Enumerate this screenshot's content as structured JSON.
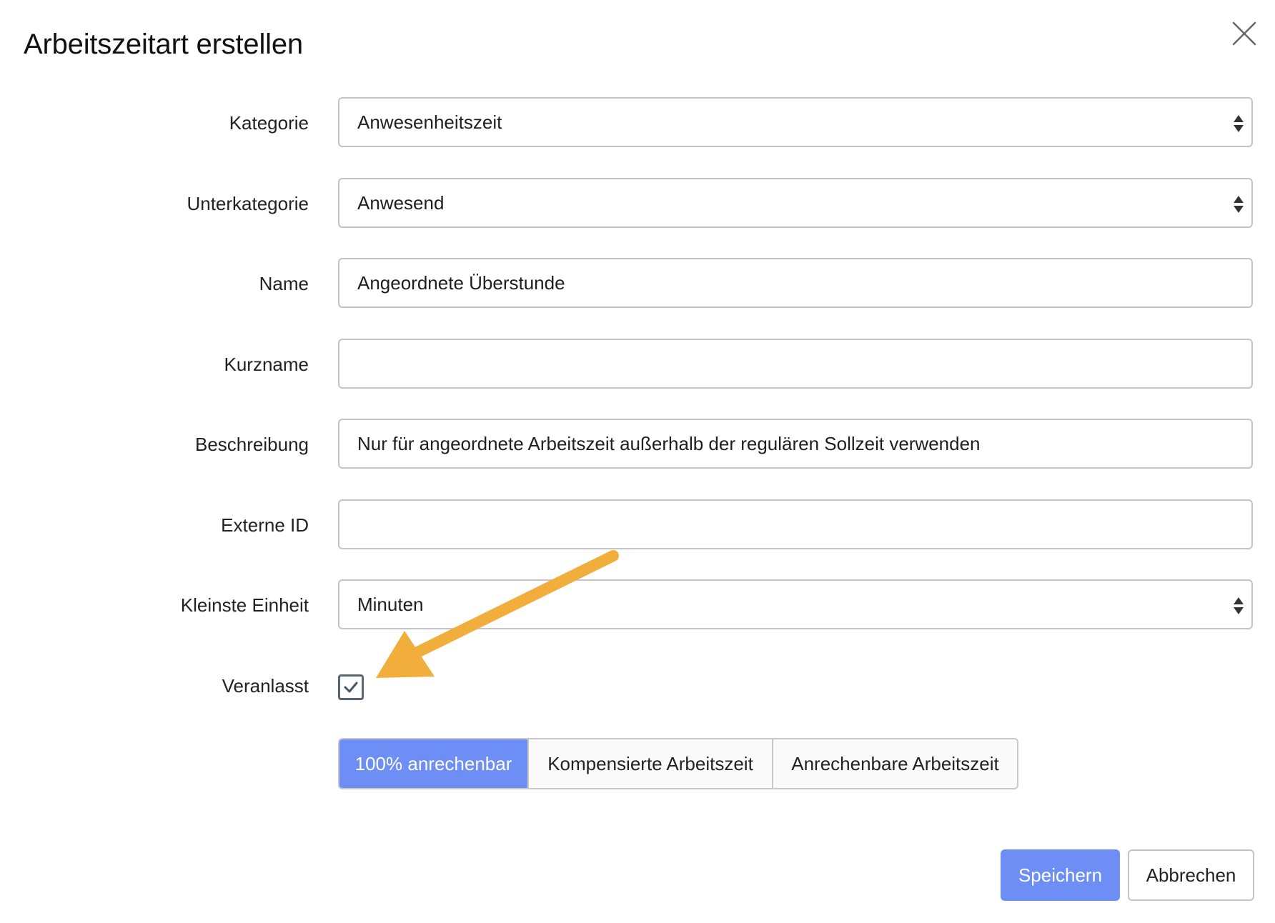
{
  "dialog": {
    "title": "Arbeitszeitart erstellen",
    "close_icon": "close-icon"
  },
  "form": {
    "kategorie": {
      "label": "Kategorie",
      "value": "Anwesenheitszeit",
      "type": "select"
    },
    "unterkategorie": {
      "label": "Unterkategorie",
      "value": "Anwesend",
      "type": "select"
    },
    "name": {
      "label": "Name",
      "value": "Angeordnete Überstunde",
      "type": "text"
    },
    "kurzname": {
      "label": "Kurzname",
      "value": "",
      "type": "text"
    },
    "beschreibung": {
      "label": "Beschreibung",
      "value": "Nur für angeordnete Arbeitszeit außerhalb der regulären Sollzeit verwenden",
      "type": "text"
    },
    "externe_id": {
      "label": "Externe ID",
      "value": "",
      "type": "text"
    },
    "kleinste_einheit": {
      "label": "Kleinste Einheit",
      "value": "Minuten",
      "type": "select"
    },
    "veranlasst": {
      "label": "Veranlasst",
      "checked": true
    }
  },
  "segments": {
    "items": [
      {
        "label": "100% anrechenbar",
        "active": true
      },
      {
        "label": "Kompensierte Arbeitszeit",
        "active": false
      },
      {
        "label": "Anrechenbare Arbeitszeit",
        "active": false
      }
    ]
  },
  "footer": {
    "save_label": "Speichern",
    "cancel_label": "Abbrechen"
  },
  "colors": {
    "accent": "#6c8ef5",
    "annotation_arrow": "#f2ae3d",
    "border": "#c4c4c4"
  },
  "annotation": {
    "icon": "arrow-annotation"
  }
}
